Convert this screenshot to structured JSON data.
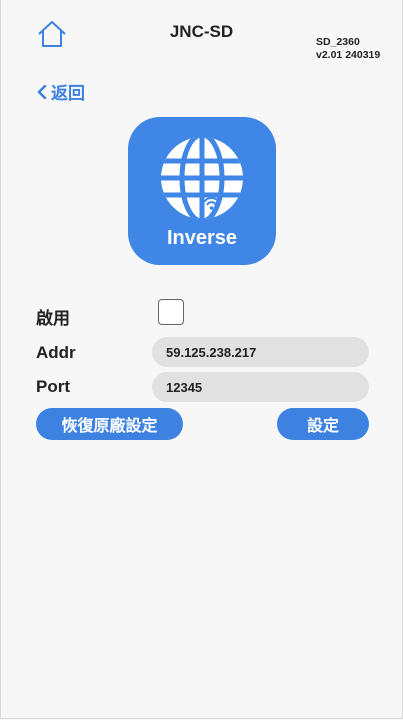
{
  "header": {
    "title": "JNC-SD",
    "model_line1": "SD_2360",
    "model_line2": "v2.01 240319",
    "home_icon": "home-icon"
  },
  "nav": {
    "back_label": "返回",
    "back_icon": "chevron-left-icon"
  },
  "app": {
    "name": "Inverse",
    "icon": "globe-wifi-icon"
  },
  "form": {
    "enable_label": "啟用",
    "enable_checked": false,
    "addr_label": "Addr",
    "addr_value": "59.125.238.217",
    "port_label": "Port",
    "port_value": "12345"
  },
  "actions": {
    "reset_label": "恢復原廠設定",
    "set_label": "設定"
  },
  "colors": {
    "accent": "#3d82e0",
    "icon_bg": "#3f86e6",
    "field_bg": "#e1e1e1",
    "page_bg": "#f7f7f7"
  }
}
